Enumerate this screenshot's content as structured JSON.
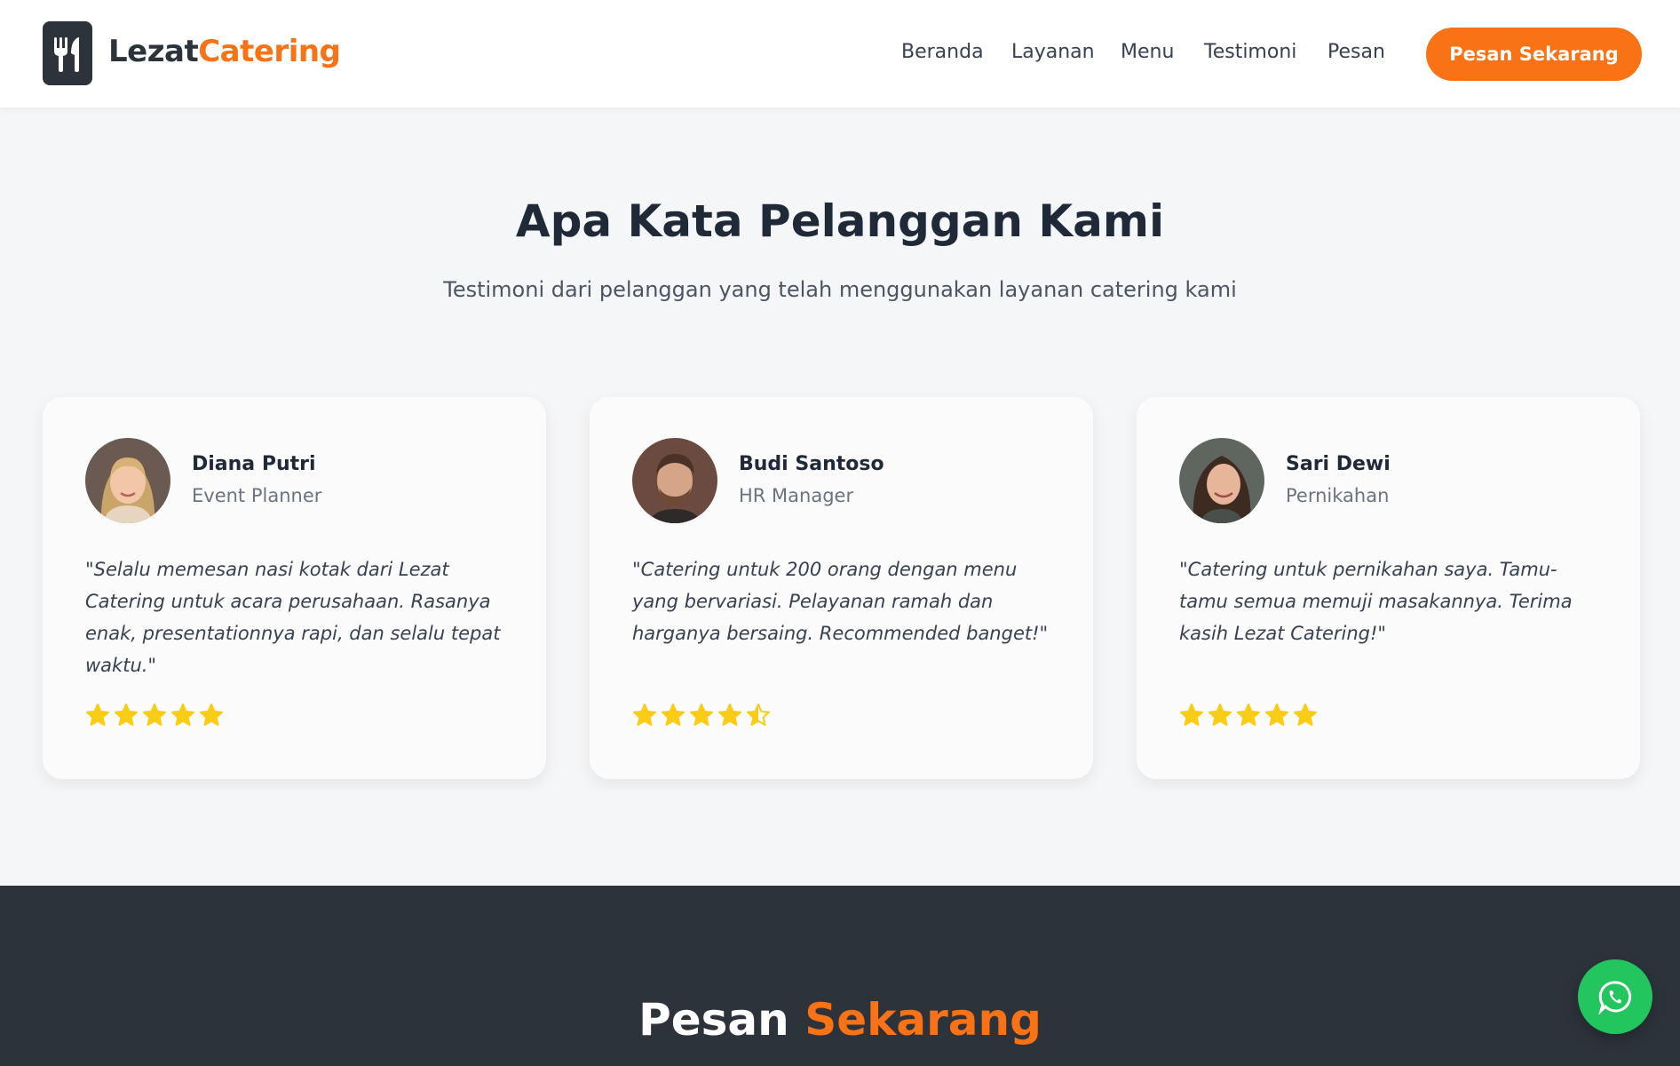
{
  "brand": {
    "name_part1": "Lezat",
    "name_part2": "Catering",
    "icon": "utensils-icon"
  },
  "nav": {
    "items": [
      "Beranda",
      "Layanan",
      "Menu",
      "Testimoni",
      "Pesan"
    ],
    "cta_label": "Pesan Sekarang"
  },
  "testimonials": {
    "title": "Apa Kata Pelanggan Kami",
    "subtitle": "Testimoni dari pelanggan yang telah menggunakan layanan catering kami",
    "cards": [
      {
        "name": "Diana Putri",
        "role": "Event Planner",
        "quote": "\"Selalu memesan nasi kotak dari Lezat Catering untuk acara perusahaan. Rasanya enak, presentationnya rapi, dan selalu tepat waktu.\"",
        "rating": 5
      },
      {
        "name": "Budi Santoso",
        "role": "HR Manager",
        "quote": "\"Catering untuk 200 orang dengan menu yang bervariasi. Pelayanan ramah dan harganya bersaing. Recommended banget!\"",
        "rating": 4.5
      },
      {
        "name": "Sari Dewi",
        "role": "Pernikahan",
        "quote": "\"Catering untuk pernikahan saya. Tamu-tamu semua memuji masakannya. Terima kasih Lezat Catering!\"",
        "rating": 5
      }
    ]
  },
  "order_section": {
    "title_part1": "Pesan",
    "title_part2": "Sekarang"
  },
  "colors": {
    "accent": "#f97316",
    "dark": "#2d333b",
    "star": "#facc15",
    "whatsapp": "#22c55e"
  },
  "floating": {
    "icon": "whatsapp-icon"
  }
}
